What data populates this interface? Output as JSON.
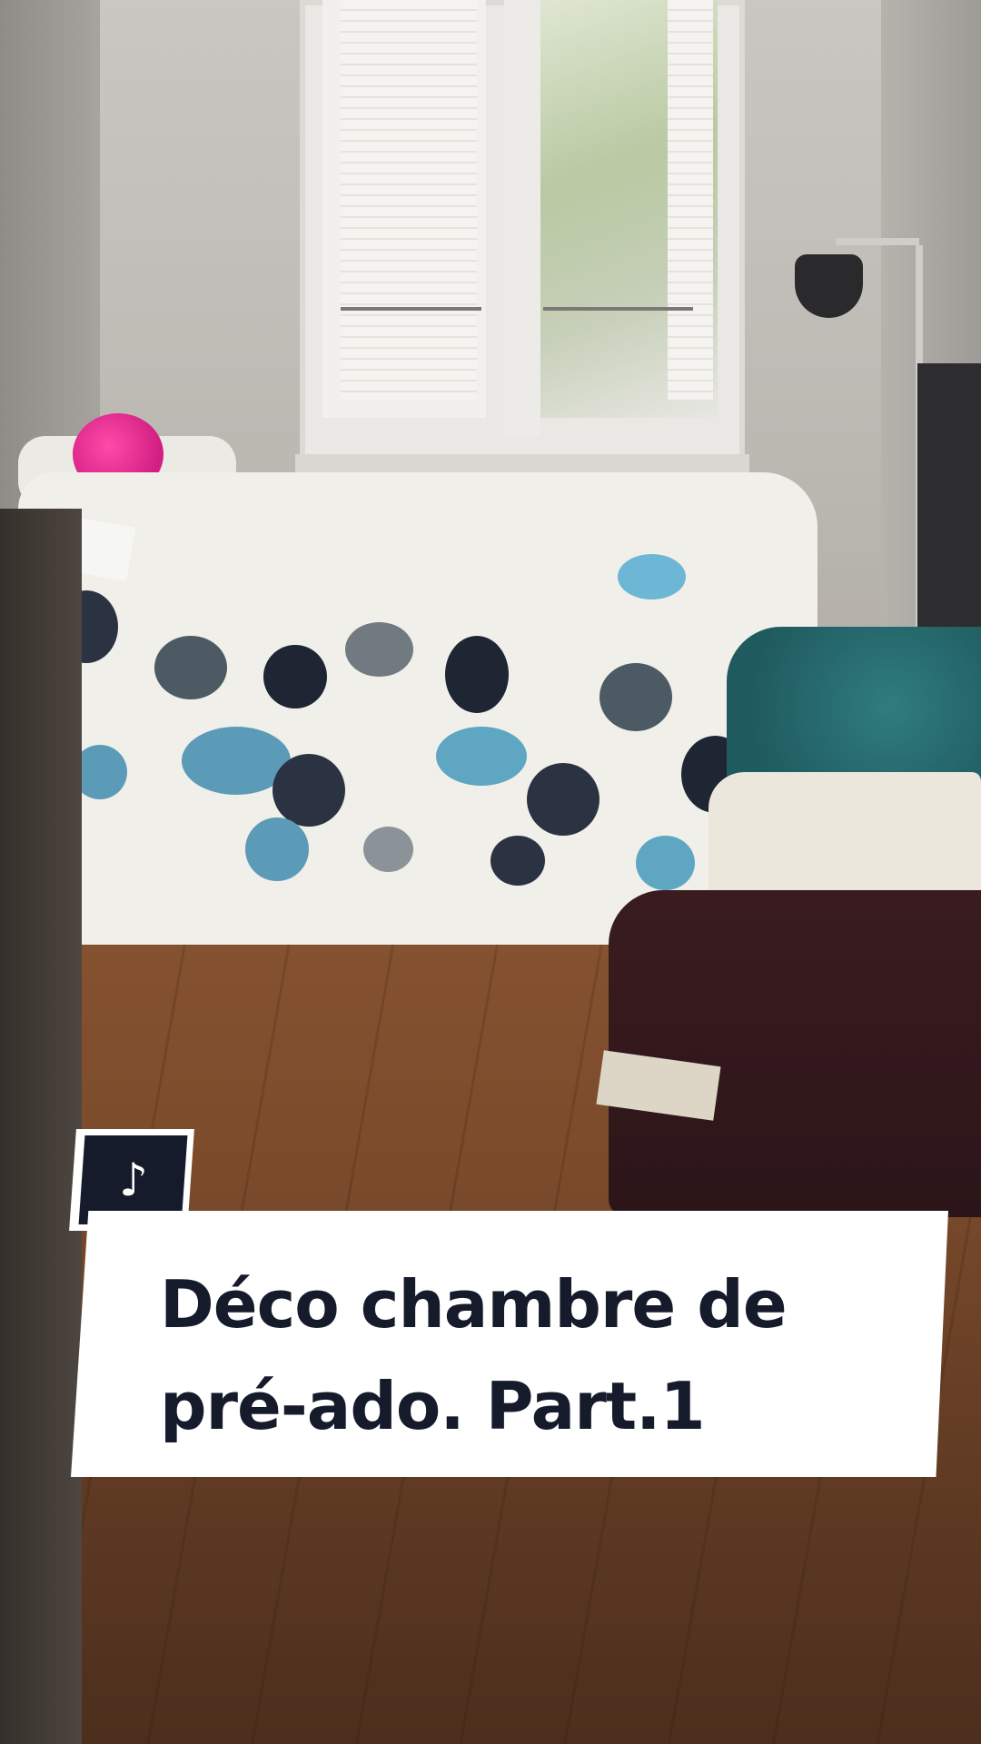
{
  "caption": {
    "line1": "Déco chambre de",
    "line2": "pré-ado. Part.1"
  },
  "logo": {
    "icon": "tiktok-note-icon",
    "glyph": "♪"
  },
  "colors": {
    "card_background": "#ffffff",
    "card_text": "#161b2b",
    "logo_background": "#161b2b"
  }
}
